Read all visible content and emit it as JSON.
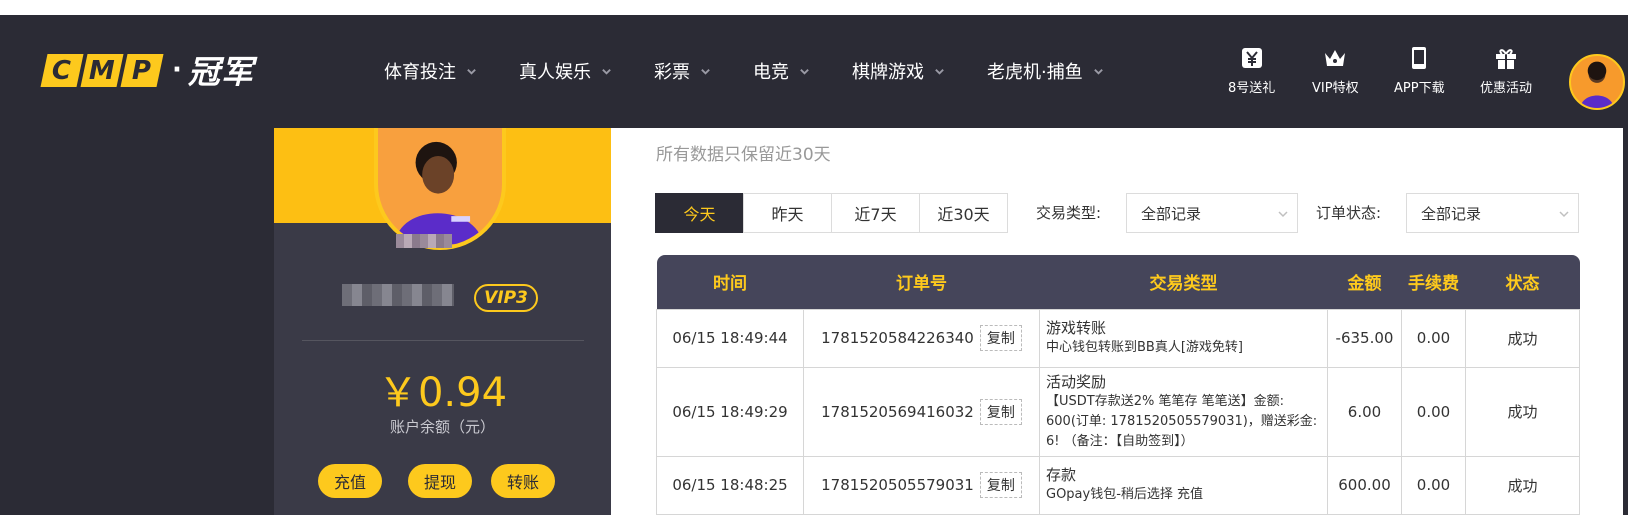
{
  "header": {
    "logo_letters": [
      "C",
      "M",
      "P"
    ],
    "logo_dot": "·",
    "logo_cn": "冠军",
    "nav": [
      {
        "label": "体育投注"
      },
      {
        "label": "真人娱乐"
      },
      {
        "label": "彩票"
      },
      {
        "label": "电竞"
      },
      {
        "label": "棋牌游戏"
      },
      {
        "label": "老虎机·捕鱼"
      }
    ],
    "quick_links": [
      {
        "label": "8号送礼",
        "icon": "gift-yen-icon"
      },
      {
        "label": "VIP特权",
        "icon": "crown-icon"
      },
      {
        "label": "APP下载",
        "icon": "phone-icon"
      },
      {
        "label": "优惠活动",
        "icon": "present-icon"
      }
    ]
  },
  "account": {
    "vip_level": "VIP3",
    "balance": "￥0.94",
    "balance_label": "账户余额（元）",
    "buttons": {
      "deposit": "充值",
      "withdraw": "提现",
      "transfer": "转账"
    }
  },
  "main": {
    "note": "所有数据只保留近30天",
    "day_tabs": [
      {
        "label": "今天"
      },
      {
        "label": "昨天"
      },
      {
        "label": "近7天"
      },
      {
        "label": "近30天"
      }
    ],
    "filters": {
      "type_label": "交易类型:",
      "type_value": "全部记录",
      "status_label": "订单状态:",
      "status_value": "全部记录"
    },
    "table": {
      "headers": [
        "时间",
        "订单号",
        "交易类型",
        "金额",
        "手续费",
        "状态"
      ],
      "copy_label": "复制",
      "rows": [
        {
          "time": "06/15 18:49:44",
          "order": "1781520584226340",
          "type_title": "游戏转账",
          "type_desc": "中心钱包转账到BB真人[游戏免转]",
          "amount": "-635.00",
          "fee": "0.00",
          "status": "成功"
        },
        {
          "time": "06/15 18:49:29",
          "order": "1781520569416032",
          "type_title": "活动奖励",
          "type_desc": "【USDT存款送2% 笔笔存 笔笔送】金额: 600(订单: 1781520505579031)，赠送彩金: 6! （备注：【自助签到】）",
          "amount": "6.00",
          "fee": "0.00",
          "status": "成功"
        },
        {
          "time": "06/15 18:48:25",
          "order": "1781520505579031",
          "type_title": "存款",
          "type_desc": "GOpay钱包-稍后选择 充值",
          "amount": "600.00",
          "fee": "0.00",
          "status": "成功"
        }
      ]
    }
  },
  "colors": {
    "brand_yellow": "#fdc91d",
    "header_bg": "#2b2b35",
    "success_green": "#3ba53b"
  }
}
